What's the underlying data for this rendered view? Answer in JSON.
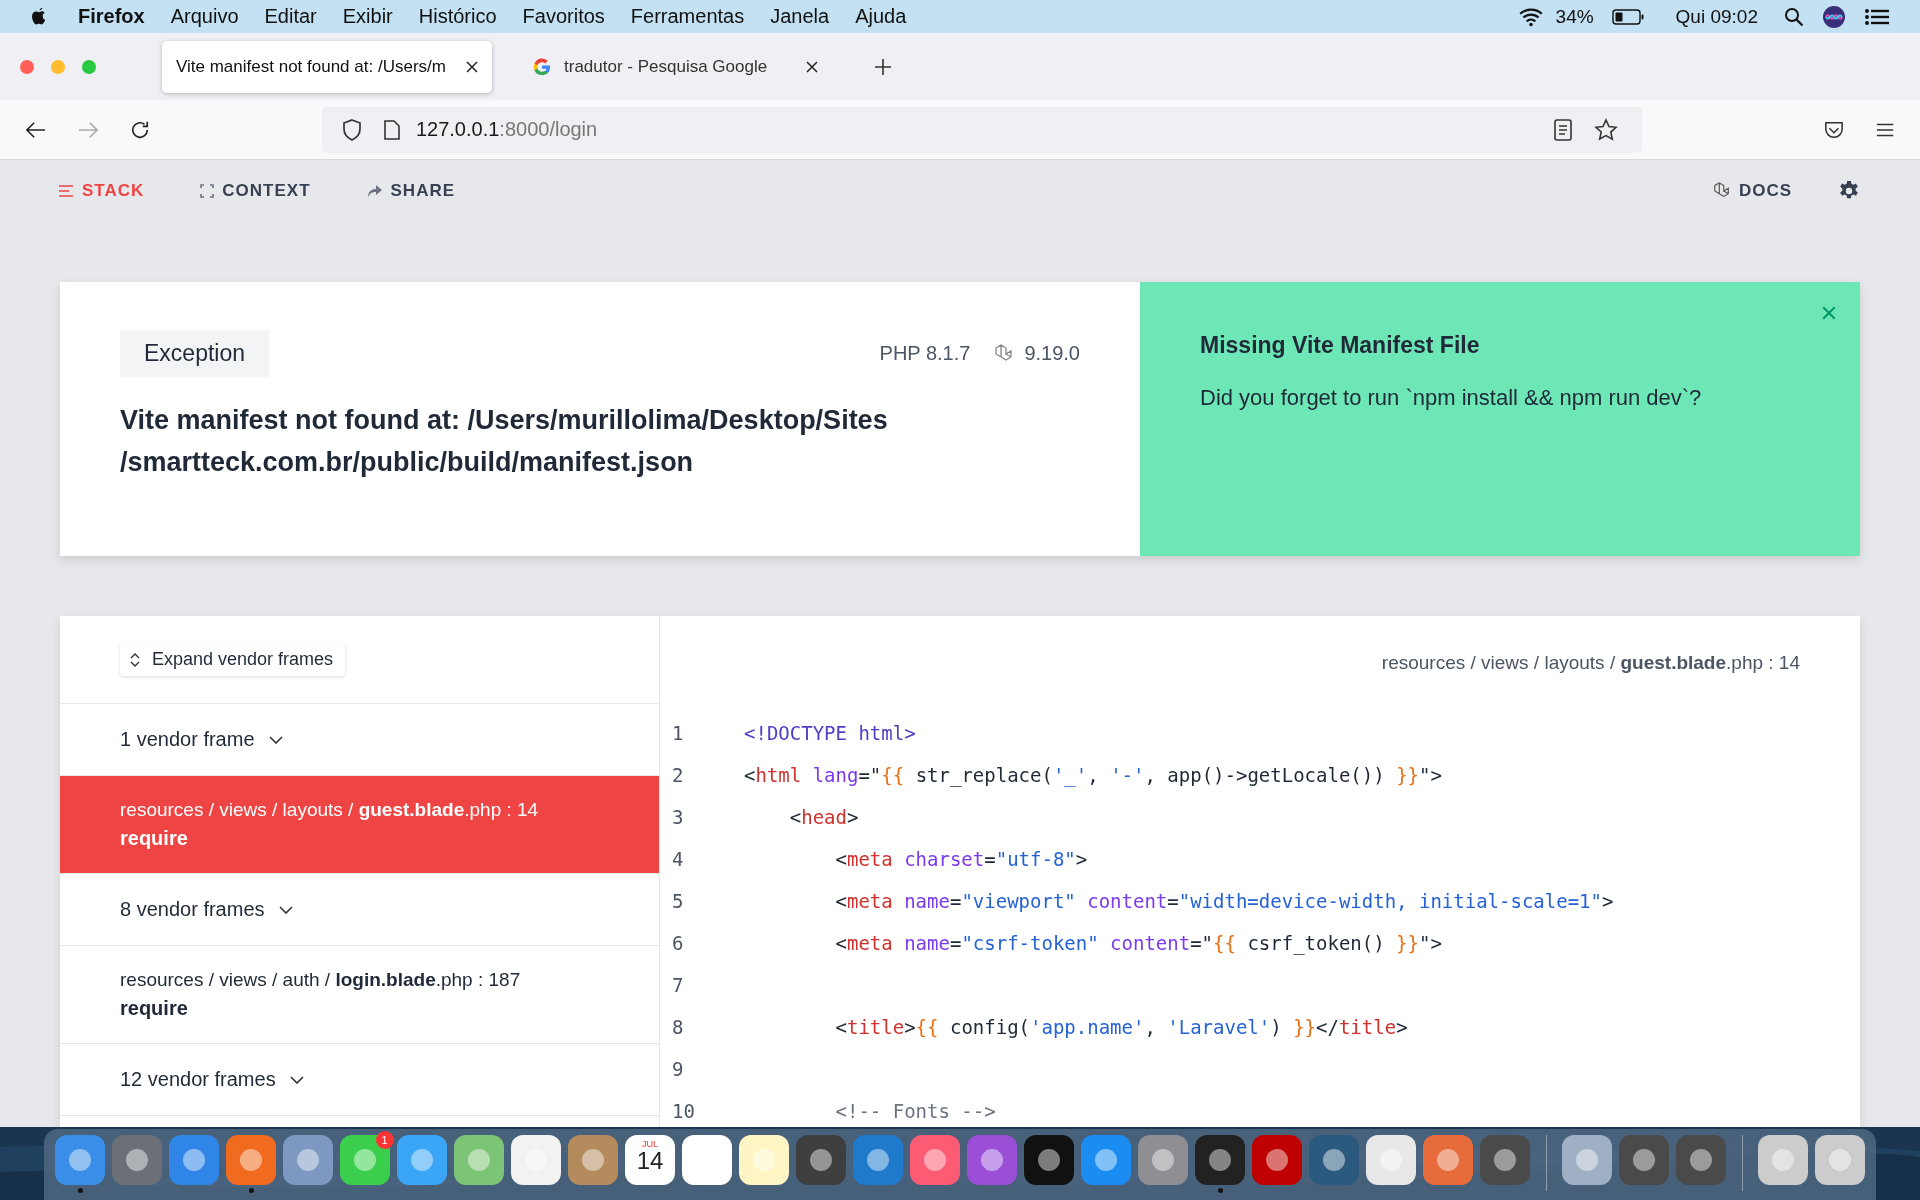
{
  "menubar": {
    "app": "Firefox",
    "menus": [
      "Arquivo",
      "Editar",
      "Exibir",
      "Histórico",
      "Favoritos",
      "Ferramentas",
      "Janela",
      "Ajuda"
    ],
    "battery": "34%",
    "clock": "Qui 09:02"
  },
  "browser": {
    "tabs": [
      {
        "title": "Vite manifest not found at: /Users/m",
        "selected": true
      },
      {
        "title": "tradutor - Pesquisa Google",
        "selected": false
      }
    ],
    "url_host": "127.0.0.1",
    "url_path": ":8000/login"
  },
  "toolbar": {
    "items": [
      {
        "label": "STACK",
        "selected": true
      },
      {
        "label": "CONTEXT",
        "selected": false
      },
      {
        "label": "SHARE",
        "selected": false
      }
    ],
    "docs": "DOCS"
  },
  "exception": {
    "badge": "Exception",
    "php": "PHP 8.1.7",
    "laravel": "9.19.0",
    "message": [
      "Vite manifest not found at: /Users/murillolima/Desktop/Sites",
      "/smartteck.com.br/public/build/manifest.json"
    ]
  },
  "solution": {
    "title": "Missing Vite Manifest File",
    "text": "Did you forget to run `npm install && npm run dev`?"
  },
  "stack": {
    "expand_button": "Expand vendor frames",
    "frames": [
      {
        "kind": "vendor_group",
        "label": "1 vendor frame",
        "expanded": false
      },
      {
        "kind": "app",
        "path": "resources / views / layouts / **guest.blade**.php : 14",
        "method": "require",
        "selected": true
      },
      {
        "kind": "vendor_group",
        "label": "8 vendor frames",
        "expanded": false
      },
      {
        "kind": "app",
        "path": "resources / views / auth / **login.blade**.php : 187",
        "method": "require",
        "selected": false
      },
      {
        "kind": "vendor_group",
        "label": "12 vendor frames",
        "expanded": false
      }
    ]
  },
  "code": {
    "file": "resources / views / layouts / **guest.blade**.php : 14",
    "lines": [
      {
        "number": "1",
        "tokens": [
          {
            "kind": "doctype",
            "text": "<!DOCTYPE html>"
          }
        ]
      },
      {
        "number": "2",
        "tokens": [
          {
            "kind": "punct",
            "text": "<"
          },
          {
            "kind": "tag",
            "text": "html"
          },
          {
            "kind": "attr",
            "text": " lang"
          },
          {
            "kind": "punct",
            "text": "=\""
          },
          {
            "kind": "blade",
            "text": "{{"
          },
          {
            "kind": "plain",
            "text": " str_replace("
          },
          {
            "kind": "str",
            "text": "'_'"
          },
          {
            "kind": "plain",
            "text": ", "
          },
          {
            "kind": "str",
            "text": "'-'"
          },
          {
            "kind": "plain",
            "text": ", app()->getLocale()) "
          },
          {
            "kind": "blade",
            "text": "}}"
          },
          {
            "kind": "punct",
            "text": "\">"
          }
        ]
      },
      {
        "number": "3",
        "tokens": [
          {
            "kind": "punct",
            "text": "    <"
          },
          {
            "kind": "tag",
            "text": "head"
          },
          {
            "kind": "punct",
            "text": ">"
          }
        ]
      },
      {
        "number": "4",
        "tokens": [
          {
            "kind": "punct",
            "text": "        <"
          },
          {
            "kind": "tag",
            "text": "meta"
          },
          {
            "kind": "attr",
            "text": " charset"
          },
          {
            "kind": "punct",
            "text": "="
          },
          {
            "kind": "str",
            "text": "\"utf-8\""
          },
          {
            "kind": "punct",
            "text": ">"
          }
        ]
      },
      {
        "number": "5",
        "tokens": [
          {
            "kind": "punct",
            "text": "        <"
          },
          {
            "kind": "tag",
            "text": "meta"
          },
          {
            "kind": "attr",
            "text": " name"
          },
          {
            "kind": "punct",
            "text": "="
          },
          {
            "kind": "str",
            "text": "\"viewport\""
          },
          {
            "kind": "attr",
            "text": " content"
          },
          {
            "kind": "punct",
            "text": "="
          },
          {
            "kind": "str",
            "text": "\"width=device-width, initial-scale=1\""
          },
          {
            "kind": "punct",
            "text": ">"
          }
        ]
      },
      {
        "number": "6",
        "tokens": [
          {
            "kind": "punct",
            "text": "        <"
          },
          {
            "kind": "tag",
            "text": "meta"
          },
          {
            "kind": "attr",
            "text": " name"
          },
          {
            "kind": "punct",
            "text": "="
          },
          {
            "kind": "str",
            "text": "\"csrf-token\""
          },
          {
            "kind": "attr",
            "text": " content"
          },
          {
            "kind": "punct",
            "text": "=\""
          },
          {
            "kind": "blade",
            "text": "{{"
          },
          {
            "kind": "plain",
            "text": " csrf_token() "
          },
          {
            "kind": "blade",
            "text": "}}"
          },
          {
            "kind": "punct",
            "text": "\">"
          }
        ]
      },
      {
        "number": "7"
      },
      {
        "number": "8",
        "tokens": [
          {
            "kind": "punct",
            "text": "        <"
          },
          {
            "kind": "tag",
            "text": "title"
          },
          {
            "kind": "punct",
            "text": ">"
          },
          {
            "kind": "blade",
            "text": "{{"
          },
          {
            "kind": "plain",
            "text": " config("
          },
          {
            "kind": "str",
            "text": "'app.name'"
          },
          {
            "kind": "plain",
            "text": ", "
          },
          {
            "kind": "str",
            "text": "'Laravel'"
          },
          {
            "kind": "plain",
            "text": ") "
          },
          {
            "kind": "blade",
            "text": "}}"
          },
          {
            "kind": "punct",
            "text": "</"
          },
          {
            "kind": "tag",
            "text": "title"
          },
          {
            "kind": "punct",
            "text": ">"
          }
        ]
      },
      {
        "number": "9"
      },
      {
        "number": "10",
        "tokens": [
          {
            "kind": "comment",
            "text": "        <!-- Fonts -->"
          }
        ]
      }
    ]
  },
  "dock": {
    "items": [
      {
        "kind": "app",
        "running": true
      },
      {
        "kind": "app",
        "running": false
      },
      {
        "kind": "app",
        "running": false
      },
      {
        "kind": "app",
        "running": true
      },
      {
        "kind": "app",
        "running": false
      },
      {
        "kind": "app",
        "running": false,
        "badge": "1"
      },
      {
        "kind": "app",
        "running": false
      },
      {
        "kind": "app",
        "running": false
      },
      {
        "kind": "app",
        "running": false
      },
      {
        "kind": "app",
        "running": false
      },
      {
        "kind": "calendar",
        "running": false,
        "month": "JUL",
        "day": "14"
      },
      {
        "kind": "app",
        "running": false
      },
      {
        "kind": "app",
        "running": false
      },
      {
        "kind": "app",
        "running": false
      },
      {
        "kind": "app",
        "running": false
      },
      {
        "kind": "app",
        "running": false
      },
      {
        "kind": "app",
        "running": false
      },
      {
        "kind": "app",
        "running": false
      },
      {
        "kind": "app",
        "running": false
      },
      {
        "kind": "app",
        "running": false
      },
      {
        "kind": "app",
        "running": true
      },
      {
        "kind": "app",
        "running": false
      },
      {
        "kind": "app",
        "running": false
      },
      {
        "kind": "app",
        "running": false
      },
      {
        "kind": "app",
        "running": false
      },
      {
        "kind": "app",
        "running": false
      },
      {
        "kind": "separator"
      },
      {
        "kind": "app",
        "running": false
      },
      {
        "kind": "app",
        "running": false
      },
      {
        "kind": "app",
        "running": false
      },
      {
        "kind": "separator"
      },
      {
        "kind": "app",
        "running": false
      },
      {
        "kind": "app",
        "running": false
      }
    ]
  }
}
